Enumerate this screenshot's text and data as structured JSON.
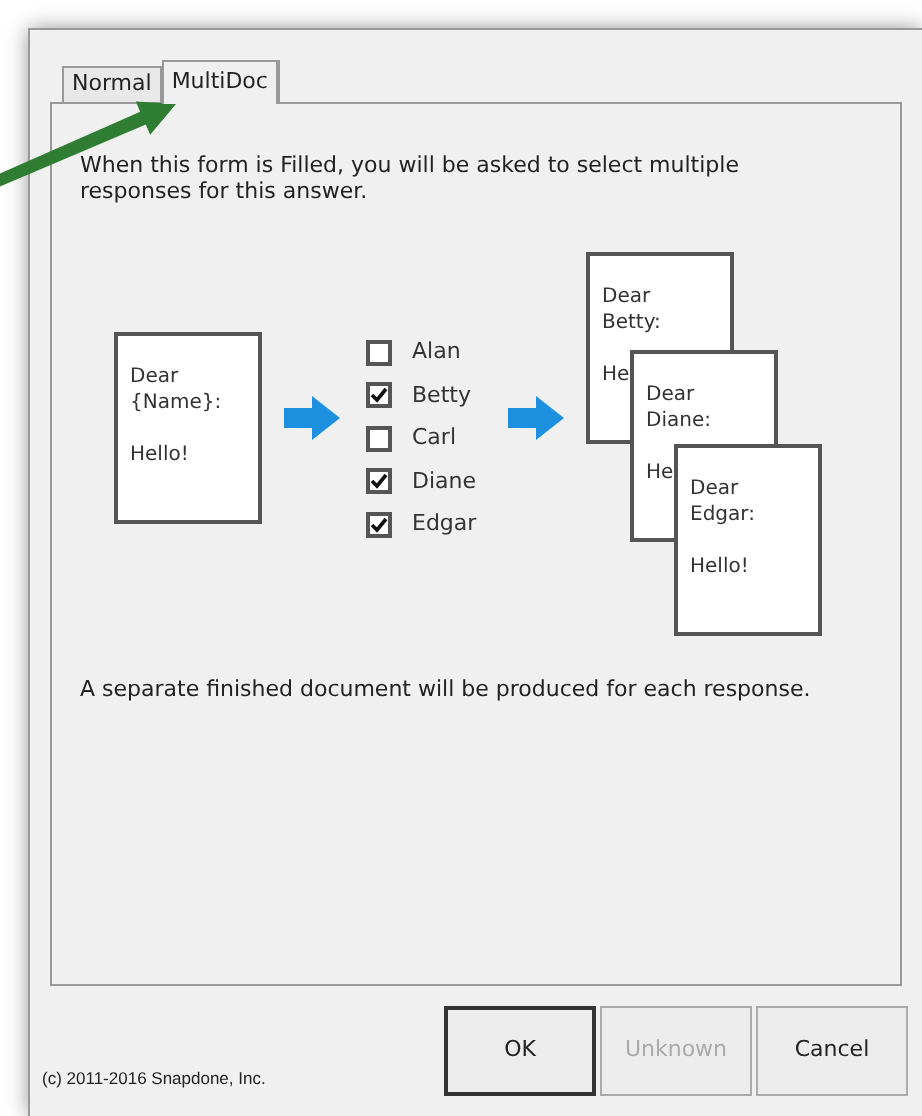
{
  "tabs": [
    {
      "label": "Normal",
      "selected": false
    },
    {
      "label": "MultiDoc",
      "selected": true
    }
  ],
  "intro": "When this form is Filled, you will be asked to select multiple responses for this answer.",
  "template": {
    "lines": [
      "Dear",
      "{Name}:"
    ],
    "body": "Hello!"
  },
  "choices": [
    {
      "label": "Alan",
      "checked": false
    },
    {
      "label": "Betty",
      "checked": true
    },
    {
      "label": "Carl",
      "checked": false
    },
    {
      "label": "Diane",
      "checked": true
    },
    {
      "label": "Edgar",
      "checked": true
    }
  ],
  "outputs": [
    {
      "lines": [
        "Dear",
        "Betty:"
      ],
      "body": "He"
    },
    {
      "lines": [
        "Dear",
        "Diane:"
      ],
      "body": "He"
    },
    {
      "lines": [
        "Dear",
        "Edgar:"
      ],
      "body": "Hello!"
    }
  ],
  "footer": "A separate finished document will be produced for each response.",
  "copyright": "(c) 2011-2016 Snapdone, Inc.",
  "buttons": [
    {
      "label": "OK",
      "disabled": false,
      "default": true
    },
    {
      "label": "Unknown",
      "disabled": true,
      "default": false
    },
    {
      "label": "Cancel",
      "disabled": false,
      "default": false
    }
  ]
}
